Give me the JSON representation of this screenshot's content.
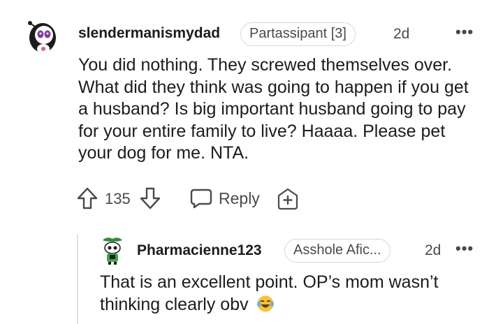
{
  "comment": {
    "username": "slendermanismydad",
    "flair": "Partassipant [3]",
    "time": "2d",
    "more": "•••",
    "body": "You did nothing. They screwed themselves over. What did they think was going to happen if you get a husband? Is big important husband going to pay for your entire family to live? Haaaa. Please pet your dog for me. NTA.",
    "votes": "135",
    "reply_label": "Reply",
    "icons": [
      "upvote-icon",
      "downvote-icon",
      "reply-bubble-icon",
      "award-add-icon",
      "more-options-icon"
    ]
  },
  "reply": {
    "username": "Pharmacienne123",
    "flair": "Asshole Afic...",
    "time": "2d",
    "more": "•••",
    "body": "That is an excellent point. OP’s mom wasn’t thinking clearly obv",
    "emoji": "tears-of-joy-emoji"
  },
  "colors": {
    "text": "#1c1c1c",
    "muted": "#4a4a4a",
    "border": "#d7d7d7",
    "thread_line": "#e0e0e0"
  }
}
